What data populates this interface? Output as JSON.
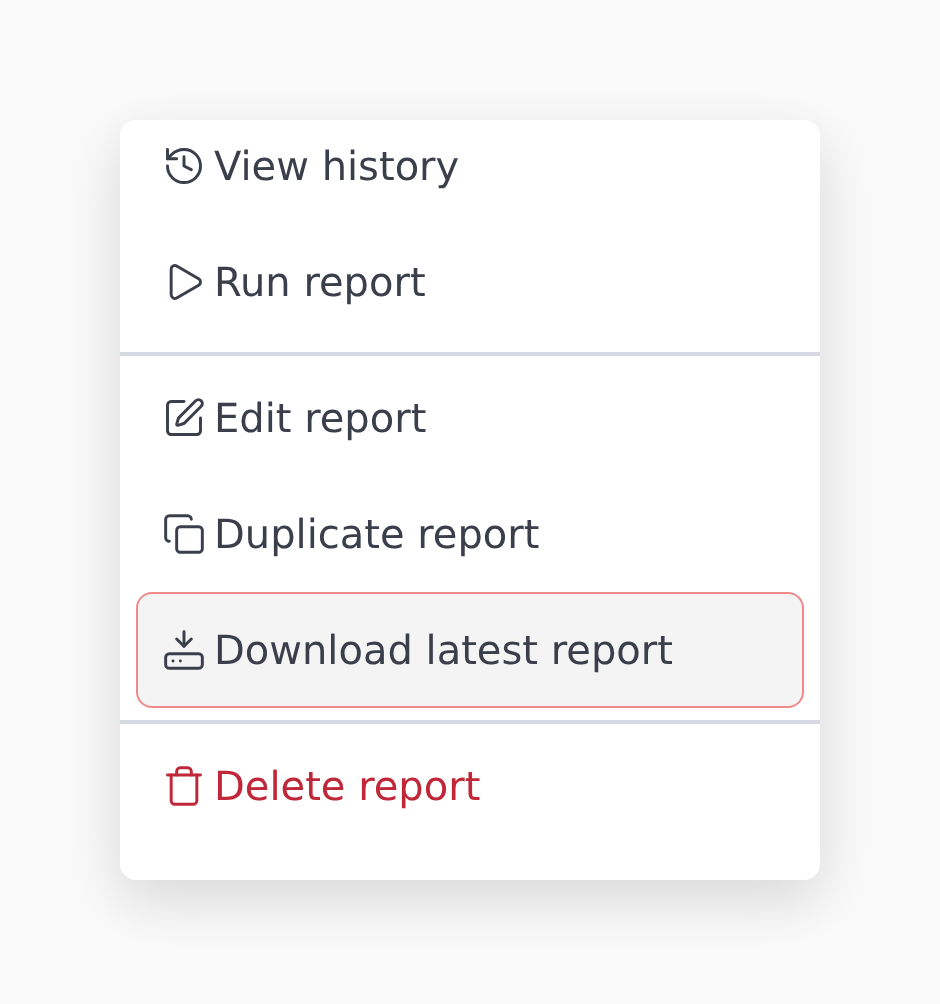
{
  "menu": {
    "groups": [
      {
        "items": [
          {
            "label": "View history",
            "kind": "normal",
            "highlighted": false
          },
          {
            "label": "Run report",
            "kind": "normal",
            "highlighted": false
          }
        ]
      },
      {
        "items": [
          {
            "label": "Edit report",
            "kind": "normal",
            "highlighted": false
          },
          {
            "label": "Duplicate report",
            "kind": "normal",
            "highlighted": false
          },
          {
            "label": "Download latest report",
            "kind": "normal",
            "highlighted": true
          }
        ]
      },
      {
        "items": [
          {
            "label": "Delete report",
            "kind": "danger",
            "highlighted": false
          }
        ]
      }
    ]
  }
}
